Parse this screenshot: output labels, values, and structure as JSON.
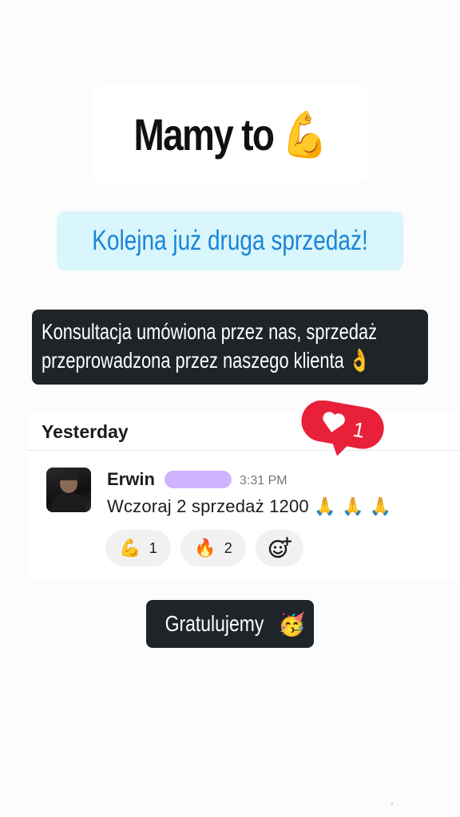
{
  "title": {
    "text": "Mamy to",
    "emoji": "💪"
  },
  "highlight": {
    "text": "Kolejna już druga sprzedaż!"
  },
  "info": {
    "line1": "Konsultacja umówiona przez nas, sprzedaż",
    "line2": "przeprowadzona przez naszego klienta",
    "emoji": "👌"
  },
  "notification": {
    "icon": "heart-icon",
    "count": "1",
    "color": "#e8203a"
  },
  "chat": {
    "day_label": "Yesterday",
    "sender": "Erwin",
    "time": "3:31 PM",
    "message": "Wczoraj 2 sprzedaż 1200",
    "message_emojis": "🙏 🙏 🙏",
    "reactions": [
      {
        "emoji": "💪",
        "icon": "flexed-biceps-icon",
        "count": "1"
      },
      {
        "emoji": "🔥",
        "icon": "fire-icon",
        "count": "2"
      },
      {
        "icon": "add-reaction-icon"
      }
    ]
  },
  "footer": {
    "text": "Gratulujemy",
    "emoji": "🥳"
  }
}
